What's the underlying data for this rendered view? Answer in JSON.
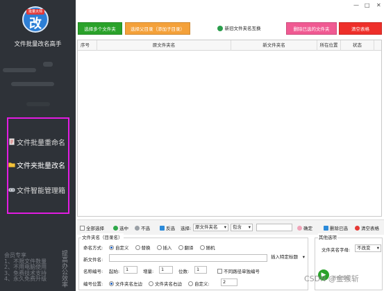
{
  "sidebar": {
    "logo_badge": "批量大师",
    "logo_char": "改",
    "app_title": "文件批量改名高手",
    "menu": [
      {
        "label": "文件批量重命名",
        "icon": "document-icon",
        "active": false
      },
      {
        "label": "文件夹批量改名",
        "icon": "folder-icon",
        "active": true
      },
      {
        "label": "文件智能管理箱",
        "icon": "gamepad-icon",
        "active": false
      }
    ],
    "promo_lines": [
      "会员专享",
      "1、不限文件数量",
      "2、不用电脑使用",
      "3、免费技术支持",
      "4、永久免费升级"
    ],
    "promo_vertical": "提高办公效率"
  },
  "window": {
    "minimize": "—",
    "restore": "□",
    "close": "✕"
  },
  "top_buttons": {
    "select_folders": "选择多个文件夹",
    "select_parent": "选择父目录（添加子目录）",
    "swap_names": "新旧文件夹名互换",
    "delete_selected": "删除已选的文件夹",
    "clear_list": "清空表格"
  },
  "colors": {
    "green": "#2aa22a",
    "orange": "#f4a13a",
    "pink": "#f05a92",
    "red": "#ee2f2a",
    "sidebar": "#2e3238",
    "highlight": "#e31ce3"
  },
  "table": {
    "columns": [
      "序号",
      "原文件夹名",
      "新文件夹名",
      "所在位置",
      "状态"
    ],
    "rows": []
  },
  "toolbar": {
    "select_all": "全部选择",
    "select": "选中",
    "unselect": "不选",
    "invert": "反选",
    "choose_label": "选择:",
    "choose_value": "原文件夹名",
    "match_value": "包含",
    "match_input": "",
    "confirm": "确定",
    "delete_selected": "删除已选",
    "clear_table": "清空表格"
  },
  "options": {
    "group_title": "文件夹名（目录名）",
    "naming_label": "命名方式:",
    "naming_options": [
      {
        "label": "自定义",
        "checked": true
      },
      {
        "label": "替换",
        "checked": false
      },
      {
        "label": "插入",
        "checked": false
      },
      {
        "label": "翻译",
        "checked": false
      },
      {
        "label": "随机",
        "checked": false
      }
    ],
    "new_name_label": "新文件名:",
    "new_name_value": "",
    "insert_dropdown": "插入特定标题",
    "numbering_label": "名称编号:",
    "start_label": "起始:",
    "start_value": "1",
    "step_label": "增量:",
    "step_value": "1",
    "digits_label": "位数:",
    "digits_value": "1",
    "independent_label": "不同路径单独编号",
    "position_label": "编号位置:",
    "position_options": [
      {
        "label": "文件夹名左边",
        "checked": true
      },
      {
        "label": "文件夹名右边",
        "checked": false
      },
      {
        "label": "自定义:",
        "checked": false
      }
    ],
    "custom_value": "2"
  },
  "other": {
    "group_title": "其他选项",
    "case_label": "文件夹名字母:",
    "case_value": "不改变",
    "start_label": "开始改名"
  },
  "watermark": "CSDN @金猴斩"
}
